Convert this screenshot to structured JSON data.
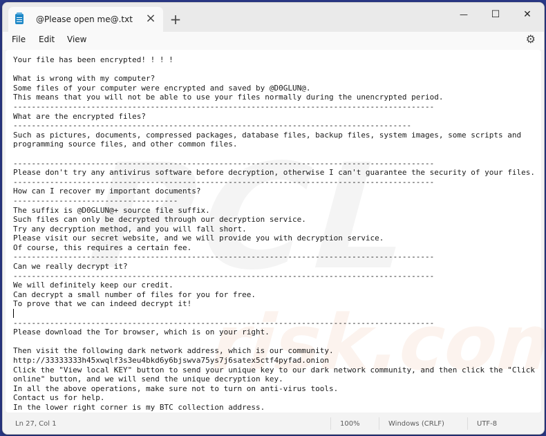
{
  "tab": {
    "title": "@Please open me@.txt",
    "close": "×",
    "new": "+"
  },
  "window_controls": {
    "minimize": "—",
    "maximize": "☐",
    "close": "✕"
  },
  "menu": {
    "file": "File",
    "edit": "Edit",
    "view": "View"
  },
  "icons": {
    "settings": "gear-icon",
    "file": "notepad-icon"
  },
  "lines": [
    "Your file has been encrypted! ! ! !",
    "",
    "What is wrong with my computer?",
    "Some files of your computer were encrypted and saved by @D0GLUN@.",
    "This means that you will not be able to use your files normally during the unencrypted period.",
    "--------------------------------------------------------------------------------------------",
    "What are the encrypted files?",
    "---------------------------------------------------------------------------------------",
    "Such as pictures, documents, compressed packages, database files, backup files, system images, some scripts and",
    "programming source files, and other common files.",
    "",
    "--------------------------------------------------------------------------------------------",
    "Please don't try any antivirus software before decryption, otherwise I can't guarantee the security of your files.",
    "--------------------------------------------------------------------------------------------",
    "How can I recover my important documents?",
    "------------------------------------",
    "The suffix is @D0GLUN@+ source file suffix.",
    "Such files can only be decrypted through our decryption service.",
    "Try any decryption method, and you will fall short.",
    "Please visit our secret website, and we will provide you with decryption service.",
    "Of course, this requires a certain fee.",
    "--------------------------------------------------------------------------------------------",
    "Can we really decrypt it?",
    "--------------------------------------------------------------------------------------------",
    "We will definitely keep our credit.",
    "Can decrypt a small number of files for you for free.",
    "To prove that we can indeed decrypt it!",
    "",
    "--------------------------------------------------------------------------------------------",
    "Please download the Tor browser, which is on your right.",
    "",
    "Then visit the following dark network address, which is our community.",
    "http://33333333h45xwqlf3s3eu4bkd6y6bjswva75ys7j6satex5ctf4pyfad.onion",
    "Click the \"View local KEY\" button to send your unique key to our dark network community, and then click the \"Click",
    "online\" button, and we will send the unique decryption key.",
    "In all the above operations, make sure not to turn on anti-virus tools.",
    "Contact us for help.",
    "In the lower right corner is my BTC collection address."
  ],
  "status": {
    "position": "Ln 27, Col 1",
    "zoom": "100%",
    "line_ending": "Windows (CRLF)",
    "encoding": "UTF-8"
  }
}
